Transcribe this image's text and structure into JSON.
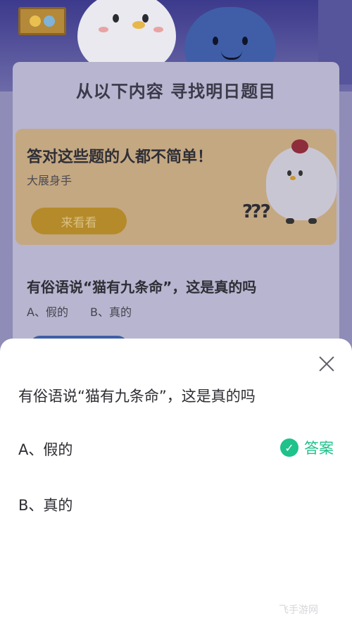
{
  "header": {
    "title": "从以下内容 寻找明日题目"
  },
  "promo_card": {
    "title": "答对这些题的人都不简单！",
    "subtitle": "大展身手",
    "button_label": "来看看"
  },
  "background_question": {
    "question": "有俗语说“猫有九条命”，这是真的吗",
    "option_a": "A、假的",
    "option_b": "B、真的"
  },
  "sheet": {
    "question": "有俗语说“猫有九条命”，这是真的吗",
    "options": [
      {
        "label": "A、假的",
        "is_answer": true
      },
      {
        "label": "B、真的",
        "is_answer": false
      }
    ],
    "answer_label": "答案",
    "answer_icon": "check-icon",
    "accent_color": "#1ec28a",
    "close_icon": "close-icon"
  },
  "watermark": "飞手游网"
}
